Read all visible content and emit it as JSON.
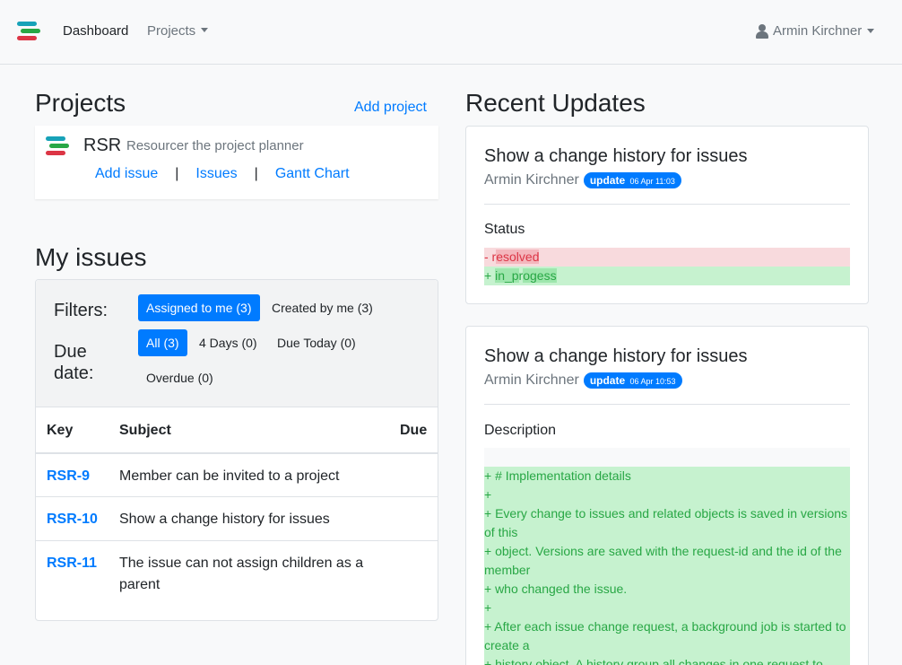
{
  "nav": {
    "brand_colors": [
      "#17a2b8",
      "#28a745",
      "#dc3545"
    ],
    "dashboard": "Dashboard",
    "projects": "Projects",
    "user": "Armin Kirchner"
  },
  "projects": {
    "title": "Projects",
    "add_label": "Add project",
    "card": {
      "key": "RSR",
      "description": "Resourcer the project planner",
      "links": [
        "Add issue",
        "Issues",
        "Gantt Chart"
      ],
      "separator": "|"
    }
  },
  "my_issues": {
    "title": "My issues",
    "filters_label": "Filters:",
    "due_label": "Due date:",
    "filters": [
      "Assigned to me (3)",
      "Created by me (3)"
    ],
    "due": [
      "All (3)",
      "4 Days (0)",
      "Due Today (0)",
      "Overdue (0)"
    ],
    "columns": [
      "Key",
      "Subject",
      "Due"
    ],
    "rows": [
      {
        "key": "RSR-9",
        "subject": "Member can be invited to a project"
      },
      {
        "key": "RSR-10",
        "subject": "Show a change history for issues"
      },
      {
        "key": "RSR-11",
        "subject": "The issue can not assign children as a parent"
      }
    ]
  },
  "updates": {
    "title": "Recent Updates",
    "items": [
      {
        "title": "Show a change history for issues",
        "author": "Armin Kirchner",
        "badge": "update",
        "date": "06 Apr 11:03",
        "field": "Status",
        "removed_prefix": "- r",
        "removed_hl": "esolved",
        "added_prefix": "+ ",
        "added_hl1": "in_p",
        "added_mid": "r",
        "added_hl2": "ogess"
      },
      {
        "title": "Show a change history for issues",
        "author": "Armin Kirchner",
        "badge": "update",
        "date": "06 Apr 10:53",
        "field": "Description",
        "lines": [
          "+ # Implementation details",
          "+",
          "+ Every change to issues and related objects is saved in versions of this",
          "+ object. Versions are saved with the request-id and the id of the member",
          "+ who changed the issue.",
          "+",
          "+ After each issue change request, a background job is started to create a",
          "+ history object. A history group all changes in one request to"
        ]
      }
    ]
  }
}
